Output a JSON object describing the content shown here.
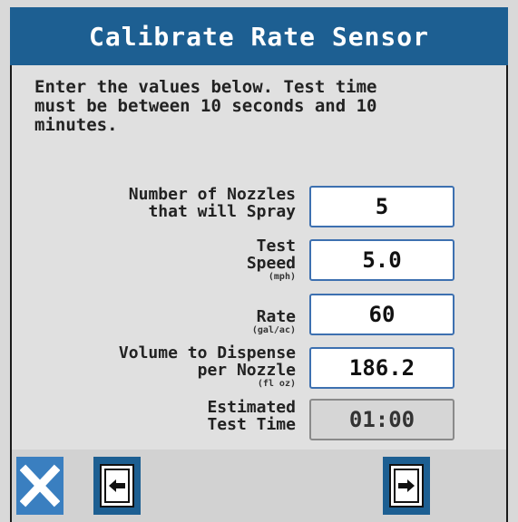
{
  "title": "Calibrate Rate Sensor",
  "instructions": "Enter the values below. Test time\nmust be between 10 seconds and 10\nminutes.",
  "fields": [
    {
      "label": "Number of Nozzles\nthat will Spray",
      "unit": "",
      "value": "5",
      "editable": true
    },
    {
      "label": "Test\nSpeed",
      "unit": "(mph)",
      "value": "5.0",
      "editable": true
    },
    {
      "label": "Rate",
      "unit": "(gal/ac)",
      "value": "60",
      "editable": true
    },
    {
      "label": "Volume to Dispense\nper Nozzle",
      "unit": "(fl oz)",
      "value": "186.2",
      "editable": true
    },
    {
      "label": "Estimated\nTest Time",
      "unit": "",
      "value": "01:00",
      "editable": false
    }
  ],
  "buttons": {
    "cancel_icon": "close-x-icon",
    "back_icon": "page-back-icon",
    "next_icon": "page-next-icon"
  },
  "colors": {
    "accent": "#1d5f92",
    "input_border": "#3d70b0",
    "background": "#d9d9d9"
  }
}
